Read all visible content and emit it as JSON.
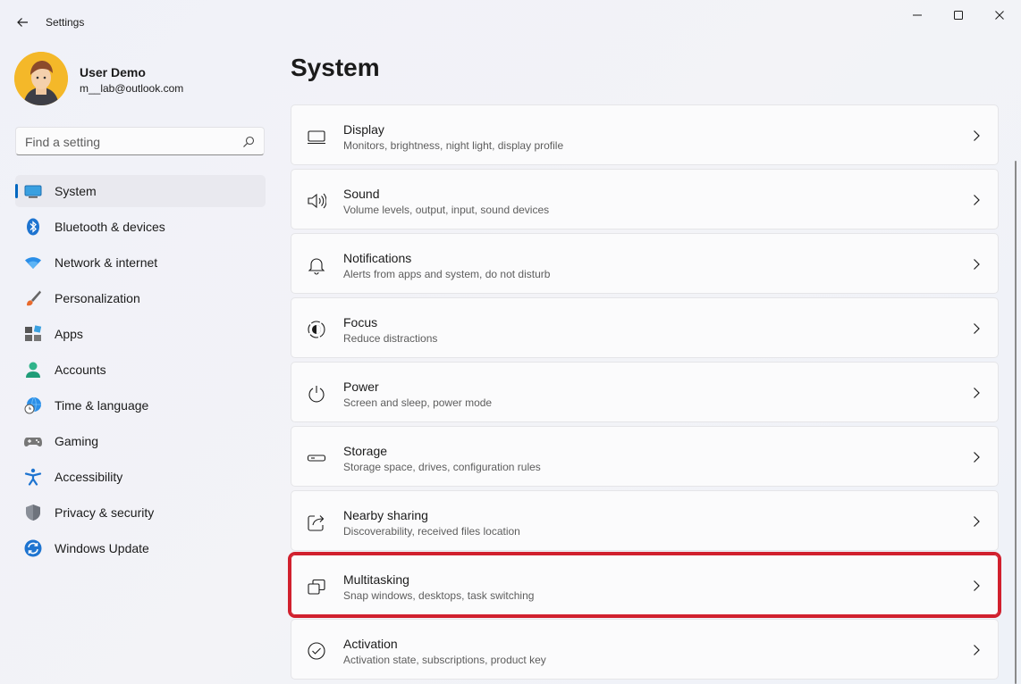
{
  "window": {
    "title": "Settings"
  },
  "profile": {
    "name": "User Demo",
    "email": "m__lab@outlook.com"
  },
  "search": {
    "placeholder": "Find a setting"
  },
  "sidebar": {
    "items": [
      {
        "label": "System",
        "icon": "monitor-icon",
        "active": true
      },
      {
        "label": "Bluetooth & devices",
        "icon": "bluetooth-icon"
      },
      {
        "label": "Network & internet",
        "icon": "wifi-icon"
      },
      {
        "label": "Personalization",
        "icon": "brush-icon"
      },
      {
        "label": "Apps",
        "icon": "apps-icon"
      },
      {
        "label": "Accounts",
        "icon": "person-icon"
      },
      {
        "label": "Time & language",
        "icon": "globe-clock-icon"
      },
      {
        "label": "Gaming",
        "icon": "gamepad-icon"
      },
      {
        "label": "Accessibility",
        "icon": "accessibility-icon"
      },
      {
        "label": "Privacy & security",
        "icon": "shield-icon"
      },
      {
        "label": "Windows Update",
        "icon": "update-icon"
      }
    ]
  },
  "main": {
    "title": "System",
    "cards": [
      {
        "title": "Display",
        "desc": "Monitors, brightness, night light, display profile",
        "icon": "display-icon"
      },
      {
        "title": "Sound",
        "desc": "Volume levels, output, input, sound devices",
        "icon": "speaker-icon"
      },
      {
        "title": "Notifications",
        "desc": "Alerts from apps and system, do not disturb",
        "icon": "bell-icon"
      },
      {
        "title": "Focus",
        "desc": "Reduce distractions",
        "icon": "focus-icon"
      },
      {
        "title": "Power",
        "desc": "Screen and sleep, power mode",
        "icon": "power-icon"
      },
      {
        "title": "Storage",
        "desc": "Storage space, drives, configuration rules",
        "icon": "drive-icon"
      },
      {
        "title": "Nearby sharing",
        "desc": "Discoverability, received files location",
        "icon": "share-icon"
      },
      {
        "title": "Multitasking",
        "desc": "Snap windows, desktops, task switching",
        "icon": "multitask-icon",
        "highlighted": true
      },
      {
        "title": "Activation",
        "desc": "Activation state, subscriptions, product key",
        "icon": "check-circle-icon"
      }
    ]
  },
  "colors": {
    "accent": "#0067c0",
    "highlight": "#d1202e"
  }
}
